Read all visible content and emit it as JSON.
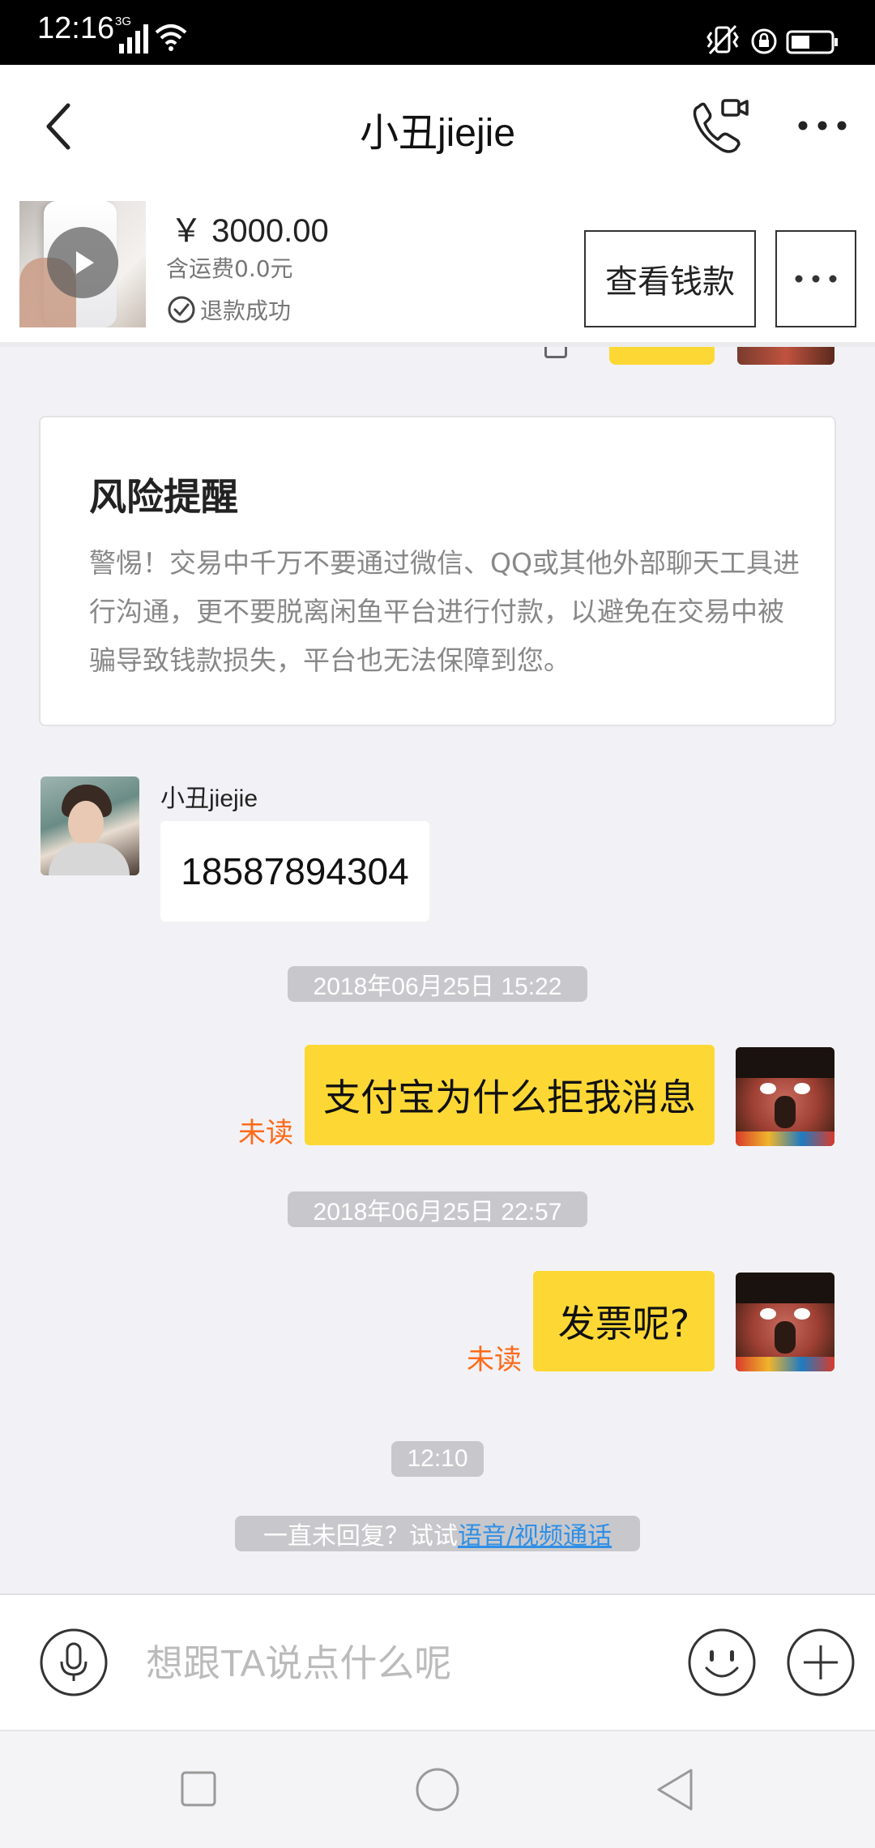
{
  "status_bar": {
    "time": "12:16",
    "network": "3G",
    "icons": [
      "signal-icon",
      "wifi-icon",
      "vibrate-icon",
      "rotation-lock-icon",
      "battery-icon"
    ]
  },
  "header": {
    "title": "小丑jiejie",
    "icons": [
      "back-arrow-icon",
      "video-call-icon",
      "more-icon"
    ]
  },
  "product": {
    "price": "￥ 3000.00",
    "shipping": "含运费0.0元",
    "status": "退款成功",
    "view_button": "查看钱款",
    "icons": [
      "play-icon",
      "check-circle-icon",
      "more-dots-icon"
    ]
  },
  "risk_card": {
    "title": "风险提醒",
    "body": "警惕！交易中千万不要通过微信、QQ或其他外部聊天工具进行沟通，更不要脱离闲鱼平台进行付款，以避免在交易中被骗导致钱款损失，平台也无法保障到您。"
  },
  "messages": {
    "received": {
      "sender": "小丑jiejie",
      "text": "18587894304"
    },
    "timestamp_1": "2018年06月25日 15:22",
    "sent_1": {
      "text": "支付宝为什么拒我消息",
      "status": "未读"
    },
    "timestamp_2": "2018年06月25日 22:57",
    "sent_2": {
      "text": "发票呢?",
      "status": "未读"
    },
    "timestamp_3": "12:10"
  },
  "hint": {
    "prefix": "一直未回复？试试 ",
    "link": "语音/视频通话"
  },
  "input_bar": {
    "placeholder": "想跟TA说点什么呢",
    "value": "",
    "icons": [
      "microphone-icon",
      "emoji-icon",
      "plus-icon"
    ]
  },
  "nav_bar": {
    "icons": [
      "recent-apps-icon",
      "home-icon",
      "back-icon"
    ]
  },
  "colors": {
    "accent_yellow": "#fdd835",
    "unread_orange": "#ff6a1a",
    "link_blue": "#2f8fe6",
    "stamp_gray": "#c8c8cc"
  }
}
